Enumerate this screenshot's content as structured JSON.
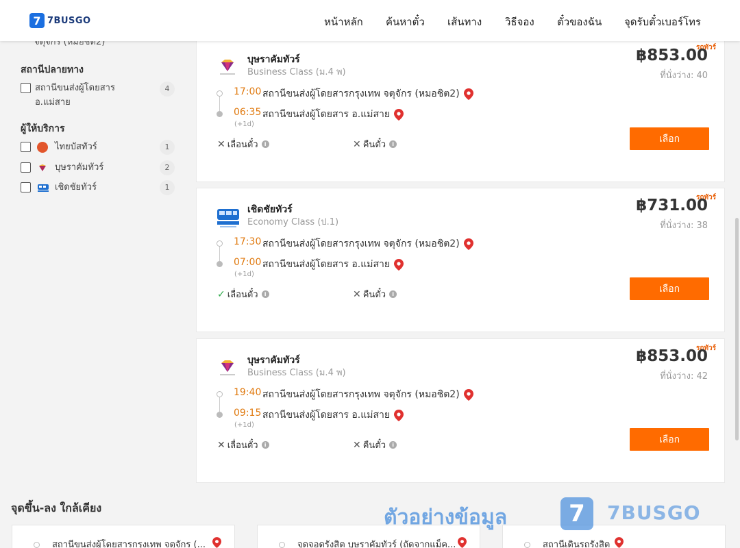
{
  "header": {
    "logo_badge": "7",
    "logo_text": "7BUSGO",
    "nav": [
      "หน้าหลัก",
      "ค้นหาตั๋ว",
      "เส้นทาง",
      "วิธีจอง",
      "ตั๋วของฉัน",
      "จุดรับตั๋วเบอร์โทร"
    ]
  },
  "sidebar": {
    "cut_text": "จตุจักร (หมอชิต2)",
    "destination_title": "สถานีปลายทาง",
    "destination": {
      "label_line1": "สถานีขนส่งผู้โดยสาร",
      "label_line2": "อ.แม่สาย",
      "count": "4"
    },
    "operator_title": "ผู้ให้บริการ",
    "operators": [
      {
        "label": "ไทยบัสทัวร์",
        "count": "1",
        "color": "#e2552b"
      },
      {
        "label": "บุษราคัมทัวร์",
        "count": "2",
        "color": "#b02a5a"
      },
      {
        "label": "เชิดชัยทัวร์",
        "count": "1",
        "color": "#1e6fd0"
      }
    ]
  },
  "trips": [
    {
      "badge": "รถทัวร์",
      "operator": "บุษราคัมทัวร์",
      "bus_class": "Business Class (ม.4 พ)",
      "price": "฿853.00",
      "seats": "ที่นั่งว่าง: 40",
      "dep_time": "17:00",
      "dep_station": "สถานีขนส่งผู้โดยสารกรุงเทพ จตุจักร (หมอชิต2)",
      "arr_time": "06:35",
      "arr_station": "สถานีขนส่งผู้โดยสาร อ.แม่สาย",
      "plus_day": "(+1d)",
      "reschedule": {
        "mark": "✕",
        "label": "เลื่อนตั๋ว",
        "allowed": false
      },
      "refund": {
        "mark": "✕",
        "label": "คืนตั๋ว",
        "allowed": false
      },
      "select_label": "เลือก",
      "logo_type": "diamond"
    },
    {
      "badge": "รถทัวร์",
      "operator": "เชิดชัยทัวร์",
      "bus_class": "Economy Class (ป.1)",
      "price": "฿731.00",
      "seats": "ที่นั่งว่าง: 38",
      "dep_time": "17:30",
      "dep_station": "สถานีขนส่งผู้โดยสารกรุงเทพ จตุจักร (หมอชิต2)",
      "arr_time": "07:00",
      "arr_station": "สถานีขนส่งผู้โดยสาร อ.แม่สาย",
      "plus_day": "(+1d)",
      "reschedule": {
        "mark": "✓",
        "label": "เลื่อนตั๋ว",
        "allowed": true
      },
      "refund": {
        "mark": "✕",
        "label": "คืนตั๋ว",
        "allowed": false
      },
      "select_label": "เลือก",
      "logo_type": "bus"
    },
    {
      "badge": "รถทัวร์",
      "operator": "บุษราคัมทัวร์",
      "bus_class": "Business Class (ม.4 พ)",
      "price": "฿853.00",
      "seats": "ที่นั่งว่าง: 42",
      "dep_time": "19:40",
      "dep_station": "สถานีขนส่งผู้โดยสารกรุงเทพ จตุจักร (หมอชิต2)",
      "arr_time": "09:15",
      "arr_station": "สถานีขนส่งผู้โดยสาร อ.แม่สาย",
      "plus_day": "(+1d)",
      "reschedule": {
        "mark": "✕",
        "label": "เลื่อนตั๋ว",
        "allowed": false
      },
      "refund": {
        "mark": "✕",
        "label": "คืนตั๋ว",
        "allowed": false
      },
      "select_label": "เลือก",
      "logo_type": "diamond"
    }
  ],
  "nearby": {
    "title": "จุดขึ้น-ลง ใกล้เคียง",
    "items": [
      "สถานีขนส่งผู้โดยสารกรุงเทพ จตุจักร (...",
      "จุดจอดรังสิต บุษราคัมทัวร์ (ถัดจากแม็ค...",
      "สถานีเดินรถรังสิต"
    ]
  },
  "watermark": {
    "text": "ตัวอย่างข้อมูล",
    "badge": "7",
    "logo": "7BUSGO"
  },
  "colors": {
    "accent": "#ff6b00",
    "time": "#e07a10",
    "pin": "#e0312f",
    "brand": "#1b6fe0"
  }
}
